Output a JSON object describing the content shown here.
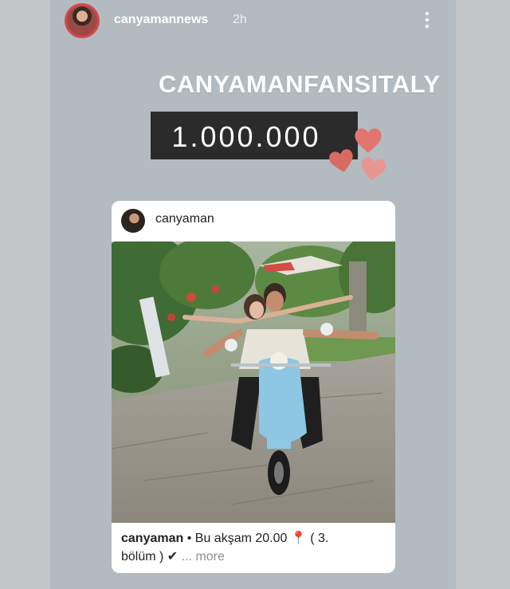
{
  "header": {
    "username": "canyamannews",
    "time": "2h",
    "menu_icon": "more-vertical-icon"
  },
  "overlay": {
    "headline": "CANYAMANFANSITALY",
    "counter": "1.000.000",
    "decoration_icon": "heart-icon",
    "heart_color": "#e27570"
  },
  "post": {
    "username": "canyaman",
    "caption": {
      "username": "canyaman",
      "separator": "•",
      "text": "Bu akşam  20.00",
      "pin": "📍",
      "text2": "( 3.",
      "text3": "bölüm ) ✔",
      "more": "... more"
    }
  }
}
